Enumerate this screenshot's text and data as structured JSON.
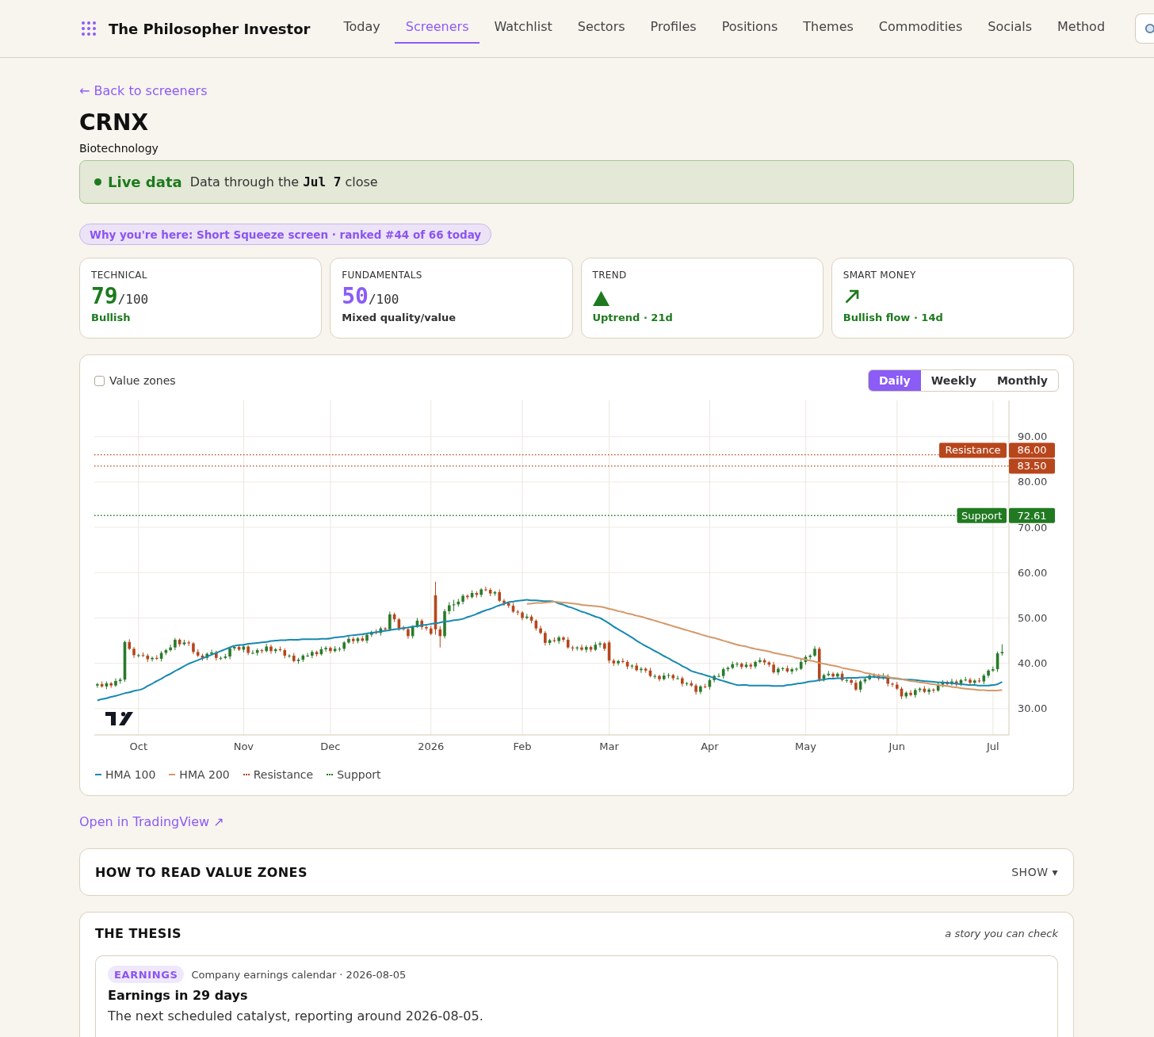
{
  "header": {
    "brand": "The Philosopher Investor",
    "nav": [
      {
        "label": "Today",
        "selected": false
      },
      {
        "label": "Screeners",
        "selected": true
      },
      {
        "label": "Watchlist",
        "selected": false
      },
      {
        "label": "Sectors",
        "selected": false
      },
      {
        "label": "Profiles",
        "selected": false
      },
      {
        "label": "Positions",
        "selected": false
      },
      {
        "label": "Themes",
        "selected": false
      },
      {
        "label": "Commodities",
        "selected": false
      },
      {
        "label": "Socials",
        "selected": false
      },
      {
        "label": "Method",
        "selected": false
      }
    ]
  },
  "back_link": "← Back to screeners",
  "ticker": "CRNX",
  "industry": "Biotechnology",
  "status_banner": {
    "label": "Live data",
    "text": "Data through the **Jul 7** close"
  },
  "reason_pill": "Why you're here: Short Squeeze screen · ranked #44 of 66 today",
  "score_cards": [
    {
      "kind": "score",
      "label": "TECHNICAL",
      "value": "79",
      "max": "/100",
      "note": "Bullish",
      "color": "#1e7a1e",
      "bullish": true
    },
    {
      "kind": "score",
      "label": "FUNDAMENTALS",
      "value": "50",
      "max": "/100",
      "note": "Mixed quality/value",
      "color": "#8b5cf6",
      "bullish": false
    },
    {
      "kind": "trend",
      "label": "TREND",
      "note": "Uptrend · 21d",
      "color": "#1e7a1e",
      "bullish": true
    },
    {
      "kind": "flow",
      "label": "SMART MONEY",
      "note": "Bullish flow · 14d",
      "color": "#1e7a1e",
      "bullish": true
    }
  ],
  "chart": {
    "value_zones": {
      "label": "Value zones",
      "checked": false
    },
    "timeframes": [
      {
        "label": "Daily",
        "selected": true
      },
      {
        "label": "Weekly",
        "selected": false
      },
      {
        "label": "Monthly",
        "selected": false
      }
    ],
    "chart_data": {
      "type": "candlestick",
      "ylim": [
        24.2,
        98
      ],
      "grid": true,
      "categories": [
        null,
        null,
        null,
        null,
        null,
        null,
        null,
        null,
        null,
        "Oct",
        null,
        null,
        null,
        null,
        null,
        null,
        null,
        null,
        null,
        null,
        null,
        null,
        null,
        null,
        null,
        null,
        null,
        null,
        null,
        null,
        null,
        null,
        "Nov",
        null,
        null,
        null,
        null,
        null,
        null,
        null,
        null,
        null,
        null,
        null,
        null,
        null,
        null,
        null,
        null,
        null,
        null,
        "Dec",
        null,
        null,
        null,
        null,
        null,
        null,
        null,
        null,
        null,
        null,
        null,
        null,
        null,
        null,
        null,
        null,
        null,
        null,
        null,
        null,
        null,
        "2026",
        null,
        null,
        null,
        null,
        null,
        null,
        null,
        null,
        null,
        null,
        null,
        null,
        null,
        null,
        null,
        null,
        null,
        null,
        null,
        "Feb",
        null,
        null,
        null,
        null,
        null,
        null,
        null,
        null,
        null,
        null,
        null,
        null,
        null,
        null,
        null,
        null,
        null,
        null,
        "Mar",
        null,
        null,
        null,
        null,
        null,
        null,
        null,
        null,
        null,
        null,
        null,
        null,
        null,
        null,
        null,
        null,
        null,
        null,
        null,
        null,
        null,
        "Apr",
        null,
        null,
        null,
        null,
        null,
        null,
        null,
        null,
        null,
        null,
        null,
        null,
        null,
        null,
        null,
        null,
        null,
        null,
        null,
        null,
        "May",
        null,
        null,
        null,
        null,
        null,
        null,
        null,
        null,
        null,
        null,
        null,
        null,
        null,
        null,
        null,
        null,
        null,
        null,
        null,
        "Jun",
        null,
        null,
        null,
        null,
        null,
        null,
        null,
        null,
        null,
        null,
        null,
        null,
        null,
        null,
        null,
        null,
        null,
        null,
        null,
        null,
        "Jul",
        null,
        null
      ],
      "ohlc": [
        [
          35.1,
          35.7,
          34.6,
          35.4
        ],
        [
          35.4,
          36.0,
          34.6,
          34.9
        ],
        [
          34.9,
          36.0,
          34.3,
          35.6
        ],
        [
          35.6,
          35.9,
          34.6,
          35.1
        ],
        [
          35.1,
          36.7,
          34.8,
          36.1
        ],
        [
          36.1,
          36.8,
          35.5,
          36.4
        ],
        [
          36.4,
          45.0,
          35.9,
          44.7
        ],
        [
          44.7,
          45.3,
          42.9,
          43.2
        ],
        [
          43.2,
          43.6,
          41.2,
          41.8
        ],
        [
          41.8,
          42.1,
          41.3,
          41.8
        ],
        [
          41.8,
          42.4,
          41.4,
          41.7
        ],
        [
          41.7,
          42.1,
          40.3,
          40.9
        ],
        [
          40.9,
          41.5,
          40.4,
          41.2
        ],
        [
          41.2,
          41.8,
          40.7,
          41.0
        ],
        [
          41.0,
          42.7,
          40.4,
          42.3
        ],
        [
          42.3,
          43.2,
          41.8,
          42.9
        ],
        [
          42.9,
          44.1,
          42.6,
          43.5
        ],
        [
          43.5,
          45.6,
          42.9,
          45.2
        ],
        [
          45.2,
          45.5,
          43.7,
          44.2
        ],
        [
          44.2,
          45.2,
          43.9,
          44.6
        ],
        [
          44.6,
          45.0,
          43.8,
          44.4
        ],
        [
          44.4,
          44.7,
          42.0,
          42.5
        ],
        [
          42.5,
          43.1,
          41.4,
          41.7
        ],
        [
          41.7,
          42.1,
          40.6,
          41.2
        ],
        [
          41.2,
          42.4,
          40.7,
          42.1
        ],
        [
          42.1,
          43.0,
          41.8,
          42.4
        ],
        [
          42.4,
          42.8,
          40.6,
          41.2
        ],
        [
          41.2,
          41.5,
          40.7,
          41.2
        ],
        [
          41.2,
          42.1,
          40.9,
          41.5
        ],
        [
          41.5,
          43.7,
          40.9,
          43.3
        ],
        [
          43.3,
          43.9,
          42.8,
          43.6
        ],
        [
          43.6,
          44.2,
          42.7,
          43.0
        ],
        [
          43.0,
          44.1,
          42.4,
          43.7
        ],
        [
          43.7,
          44.0,
          41.8,
          42.3
        ],
        [
          42.3,
          42.9,
          42.0,
          42.3
        ],
        [
          42.3,
          43.3,
          41.7,
          42.9
        ],
        [
          42.9,
          43.2,
          42.2,
          42.7
        ],
        [
          42.7,
          44.3,
          42.4,
          43.7
        ],
        [
          43.7,
          44.1,
          42.1,
          42.7
        ],
        [
          42.7,
          43.4,
          42.2,
          43.1
        ],
        [
          43.1,
          43.7,
          42.6,
          42.9
        ],
        [
          42.9,
          43.3,
          41.1,
          41.7
        ],
        [
          41.7,
          42.0,
          41.2,
          41.7
        ],
        [
          41.7,
          42.3,
          40.2,
          40.5
        ],
        [
          40.5,
          41.2,
          39.9,
          40.8
        ],
        [
          40.8,
          42.0,
          40.3,
          41.7
        ],
        [
          41.7,
          42.3,
          41.4,
          41.7
        ],
        [
          41.7,
          42.9,
          41.1,
          42.5
        ],
        [
          42.5,
          42.8,
          41.5,
          42.0
        ],
        [
          42.0,
          43.7,
          41.7,
          43.1
        ],
        [
          43.1,
          43.8,
          42.5,
          43.4
        ],
        [
          43.4,
          43.7,
          42.2,
          42.7
        ],
        [
          42.7,
          43.8,
          42.4,
          43.2
        ],
        [
          43.2,
          43.6,
          42.6,
          43.2
        ],
        [
          43.2,
          44.9,
          42.7,
          44.6
        ],
        [
          44.6,
          46.0,
          44.3,
          45.4
        ],
        [
          45.4,
          45.8,
          44.3,
          44.9
        ],
        [
          44.9,
          45.8,
          44.4,
          45.5
        ],
        [
          45.5,
          46.1,
          44.7,
          45.0
        ],
        [
          45.0,
          46.7,
          44.4,
          46.3
        ],
        [
          46.3,
          47.2,
          45.8,
          46.9
        ],
        [
          46.9,
          47.5,
          46.4,
          46.7
        ],
        [
          46.7,
          48.1,
          46.1,
          47.7
        ],
        [
          47.7,
          48.0,
          47.0,
          47.5
        ],
        [
          47.5,
          51.4,
          47.2,
          50.8
        ],
        [
          50.8,
          51.2,
          49.1,
          49.7
        ],
        [
          49.7,
          50.0,
          47.2,
          47.7
        ],
        [
          47.7,
          48.3,
          47.2,
          47.5
        ],
        [
          47.5,
          47.9,
          45.4,
          46.0
        ],
        [
          46.0,
          48.4,
          45.5,
          48.1
        ],
        [
          48.1,
          50.0,
          47.8,
          49.4
        ],
        [
          49.4,
          49.8,
          47.4,
          48.0
        ],
        [
          48.0,
          48.3,
          47.2,
          47.7
        ],
        [
          47.7,
          48.3,
          46.2,
          46.5
        ],
        [
          55.0,
          58.0,
          46.3,
          47.5
        ],
        [
          47.5,
          48.2,
          43.5,
          46.0
        ],
        [
          46.0,
          52.0,
          45.5,
          51.5
        ],
        [
          51.5,
          53.5,
          50.8,
          52.8
        ],
        [
          52.8,
          54.0,
          51.5,
          53.0
        ],
        [
          53.0,
          54.2,
          52.5,
          53.6
        ],
        [
          53.6,
          55.3,
          53.0,
          54.9
        ],
        [
          54.9,
          55.2,
          54.1,
          54.6
        ],
        [
          54.6,
          56.1,
          54.3,
          55.5
        ],
        [
          55.5,
          55.9,
          54.5,
          55.1
        ],
        [
          55.1,
          56.6,
          54.6,
          56.3
        ],
        [
          56.3,
          56.9,
          55.9,
          56.2
        ],
        [
          56.2,
          56.6,
          54.8,
          55.4
        ],
        [
          55.4,
          56.0,
          54.9,
          55.7
        ],
        [
          55.7,
          56.3,
          53.5,
          53.8
        ],
        [
          53.8,
          54.2,
          52.7,
          53.3
        ],
        [
          53.3,
          53.6,
          52.2,
          52.7
        ],
        [
          52.7,
          53.3,
          51.1,
          51.4
        ],
        [
          51.4,
          51.8,
          50.6,
          51.2
        ],
        [
          51.2,
          51.5,
          49.5,
          50.0
        ],
        [
          50.0,
          50.9,
          49.7,
          50.3
        ],
        [
          50.3,
          50.7,
          48.8,
          49.4
        ],
        [
          49.4,
          49.7,
          47.2,
          47.7
        ],
        [
          47.7,
          48.3,
          46.4,
          46.7
        ],
        [
          46.7,
          47.1,
          43.9,
          44.5
        ],
        [
          44.5,
          45.4,
          44.0,
          45.1
        ],
        [
          45.1,
          45.7,
          44.6,
          44.9
        ],
        [
          44.9,
          46.1,
          44.3,
          45.7
        ],
        [
          45.7,
          46.0,
          44.7,
          45.2
        ],
        [
          45.2,
          45.8,
          43.2,
          43.5
        ],
        [
          43.5,
          43.9,
          42.7,
          43.3
        ],
        [
          43.3,
          43.8,
          42.8,
          43.5
        ],
        [
          43.5,
          44.1,
          42.7,
          43.0
        ],
        [
          43.0,
          44.0,
          42.4,
          43.6
        ],
        [
          43.6,
          43.9,
          42.5,
          43.0
        ],
        [
          43.0,
          44.7,
          42.7,
          44.1
        ],
        [
          44.1,
          44.8,
          43.5,
          44.4
        ],
        [
          44.4,
          44.7,
          42.7,
          43.2
        ],
        [
          44.6,
          45.0,
          40.0,
          40.6
        ],
        [
          40.6,
          41.0,
          39.4,
          40.0
        ],
        [
          40.0,
          40.8,
          39.5,
          40.5
        ],
        [
          40.5,
          41.1,
          40.0,
          40.3
        ],
        [
          40.3,
          40.7,
          38.7,
          39.3
        ],
        [
          39.3,
          39.8,
          38.8,
          39.5
        ],
        [
          39.5,
          40.1,
          38.2,
          38.5
        ],
        [
          38.5,
          39.2,
          37.9,
          38.8
        ],
        [
          38.8,
          39.1,
          37.9,
          38.4
        ],
        [
          38.4,
          39.0,
          36.9,
          37.2
        ],
        [
          37.2,
          37.6,
          36.6,
          37.2
        ],
        [
          37.2,
          37.5,
          36.0,
          36.5
        ],
        [
          36.5,
          37.9,
          36.2,
          37.3
        ],
        [
          37.3,
          37.8,
          36.7,
          37.4
        ],
        [
          37.4,
          37.7,
          36.2,
          36.7
        ],
        [
          36.7,
          37.3,
          36.4,
          36.7
        ],
        [
          36.7,
          37.1,
          34.9,
          35.5
        ],
        [
          35.5,
          35.9,
          35.0,
          35.6
        ],
        [
          35.6,
          36.2,
          34.8,
          35.1
        ],
        [
          35.1,
          35.5,
          33.1,
          33.7
        ],
        [
          33.7,
          35.2,
          33.2,
          34.9
        ],
        [
          34.9,
          35.5,
          34.5,
          34.8
        ],
        [
          34.8,
          36.7,
          34.2,
          36.3
        ],
        [
          36.3,
          37.5,
          35.8,
          37.2
        ],
        [
          37.2,
          37.8,
          36.9,
          37.2
        ],
        [
          37.2,
          39.1,
          36.6,
          38.7
        ],
        [
          38.7,
          39.3,
          38.2,
          39.0
        ],
        [
          39.0,
          40.4,
          38.7,
          39.8
        ],
        [
          39.8,
          40.3,
          39.2,
          39.9
        ],
        [
          39.9,
          40.2,
          38.7,
          39.2
        ],
        [
          39.2,
          40.3,
          38.9,
          39.7
        ],
        [
          39.7,
          40.1,
          38.7,
          39.3
        ],
        [
          39.3,
          40.6,
          38.8,
          40.3
        ],
        [
          40.3,
          41.3,
          40.0,
          40.7
        ],
        [
          40.7,
          41.1,
          39.6,
          40.2
        ],
        [
          40.2,
          40.5,
          39.2,
          39.7
        ],
        [
          39.7,
          40.3,
          37.7,
          38.0
        ],
        [
          38.0,
          39.2,
          37.4,
          38.8
        ],
        [
          38.8,
          39.2,
          38.3,
          38.9
        ],
        [
          38.9,
          39.5,
          37.9,
          38.2
        ],
        [
          38.2,
          39.1,
          37.6,
          38.7
        ],
        [
          38.7,
          39.1,
          38.2,
          38.8
        ],
        [
          38.8,
          40.9,
          38.5,
          40.3
        ],
        [
          40.3,
          41.8,
          39.7,
          41.4
        ],
        [
          41.4,
          42.0,
          40.9,
          41.7
        ],
        [
          41.7,
          43.8,
          41.4,
          43.2
        ],
        [
          43.2,
          43.6,
          35.9,
          36.5
        ],
        [
          36.5,
          37.7,
          36.0,
          37.4
        ],
        [
          37.4,
          38.3,
          37.1,
          37.7
        ],
        [
          37.7,
          38.1,
          36.5,
          37.1
        ],
        [
          37.1,
          38.0,
          36.6,
          37.7
        ],
        [
          37.7,
          38.3,
          36.0,
          36.3
        ],
        [
          36.3,
          36.7,
          35.7,
          36.3
        ],
        [
          36.3,
          36.6,
          35.2,
          35.7
        ],
        [
          35.7,
          36.3,
          33.9,
          34.2
        ],
        [
          34.2,
          36.4,
          33.6,
          36.0
        ],
        [
          36.0,
          36.8,
          35.5,
          36.5
        ],
        [
          36.5,
          37.9,
          36.2,
          37.3
        ],
        [
          37.3,
          37.8,
          36.7,
          37.4
        ],
        [
          37.4,
          37.7,
          36.2,
          36.7
        ],
        [
          36.7,
          37.8,
          36.4,
          37.2
        ],
        [
          37.2,
          37.6,
          34.9,
          35.5
        ],
        [
          35.5,
          35.8,
          34.8,
          35.3
        ],
        [
          35.3,
          35.9,
          34.1,
          34.4
        ],
        [
          34.4,
          34.8,
          32.1,
          32.7
        ],
        [
          32.7,
          33.8,
          32.2,
          33.5
        ],
        [
          33.5,
          34.1,
          32.7,
          33.0
        ],
        [
          33.0,
          34.5,
          32.4,
          34.1
        ],
        [
          34.1,
          34.7,
          33.6,
          34.4
        ],
        [
          34.4,
          35.0,
          33.4,
          33.7
        ],
        [
          33.7,
          34.6,
          33.1,
          34.2
        ],
        [
          34.2,
          34.5,
          33.5,
          34.0
        ],
        [
          34.0,
          35.9,
          33.7,
          35.3
        ],
        [
          35.3,
          36.3,
          34.7,
          35.9
        ],
        [
          35.9,
          36.2,
          34.9,
          35.4
        ],
        [
          35.4,
          36.6,
          35.1,
          36.0
        ],
        [
          36.0,
          36.4,
          34.9,
          35.5
        ],
        [
          35.5,
          36.6,
          35.0,
          36.3
        ],
        [
          36.3,
          37.0,
          36.0,
          36.4
        ],
        [
          36.4,
          36.8,
          35.1,
          35.7
        ],
        [
          35.7,
          36.5,
          35.2,
          36.2
        ],
        [
          36.2,
          36.8,
          35.7,
          36.0
        ],
        [
          36.0,
          37.7,
          35.4,
          37.3
        ],
        [
          37.3,
          38.7,
          36.8,
          38.4
        ],
        [
          38.4,
          39.3,
          38.1,
          38.7
        ],
        [
          38.7,
          42.6,
          38.1,
          42.2
        ],
        [
          42.2,
          44.2,
          41.7,
          42.5
        ]
      ],
      "series": [
        {
          "name": "HMA 100",
          "type": "line",
          "color": "#1789b0",
          "values": [
            31.8,
            32.1,
            32.3,
            32.6,
            32.8,
            33.1,
            33.4,
            33.6,
            33.9,
            34.1,
            34.4,
            35.0,
            35.5,
            36.1,
            36.6,
            37.2,
            37.7,
            38.3,
            38.8,
            39.4,
            39.9,
            40.3,
            40.7,
            41.1,
            41.5,
            41.9,
            42.3,
            42.7,
            43.1,
            43.5,
            43.9,
            44.0,
            44.1,
            44.3,
            44.4,
            44.5,
            44.6,
            44.7,
            44.9,
            45.0,
            45.1,
            45.1,
            45.2,
            45.2,
            45.2,
            45.3,
            45.3,
            45.3,
            45.3,
            45.4,
            45.4,
            45.5,
            45.7,
            45.8,
            45.9,
            46.1,
            46.2,
            46.3,
            46.4,
            46.6,
            46.7,
            46.9,
            47.0,
            47.2,
            47.3,
            47.5,
            47.6,
            47.8,
            47.9,
            48.1,
            48.2,
            48.4,
            48.5,
            48.7,
            48.8,
            49.0,
            49.2,
            49.3,
            49.5,
            49.6,
            49.8,
            50.2,
            50.5,
            50.9,
            51.3,
            51.7,
            52.0,
            52.4,
            52.8,
            53.1,
            53.5,
            53.6,
            53.8,
            53.9,
            54.0,
            53.9,
            53.9,
            53.8,
            53.7,
            53.7,
            53.6,
            53.2,
            52.9,
            52.5,
            52.2,
            51.8,
            51.4,
            51.1,
            50.7,
            50.3,
            50.0,
            49.4,
            48.8,
            48.1,
            47.5,
            46.9,
            46.3,
            45.7,
            45.0,
            44.4,
            43.8,
            43.3,
            42.7,
            42.2,
            41.6,
            41.1,
            40.5,
            40.0,
            39.4,
            38.9,
            38.3,
            38.0,
            37.7,
            37.4,
            37.1,
            36.8,
            36.4,
            36.1,
            35.8,
            35.5,
            35.2,
            35.2,
            35.2,
            35.1,
            35.1,
            35.1,
            35.1,
            35.1,
            35.0,
            35.0,
            35.0,
            35.2,
            35.3,
            35.5,
            35.6,
            35.8,
            36.0,
            36.1,
            36.3,
            36.4,
            36.6,
            36.6,
            36.7,
            36.7,
            36.8,
            36.8,
            36.8,
            36.9,
            36.9,
            37.0,
            37.0,
            36.9,
            36.8,
            36.8,
            36.7,
            36.6,
            36.5,
            36.4,
            36.4,
            36.3,
            36.2,
            36.1,
            36.0,
            35.9,
            35.8,
            35.8,
            35.7,
            35.6,
            35.5,
            35.4,
            35.3,
            35.2,
            35.2,
            35.1,
            35.1,
            35.1,
            35.2,
            35.4,
            35.9
          ]
        },
        {
          "name": "HMA 200",
          "type": "line",
          "color": "#d4996a",
          "values": [
            null,
            null,
            null,
            null,
            null,
            null,
            null,
            null,
            null,
            null,
            null,
            null,
            null,
            null,
            null,
            null,
            null,
            null,
            null,
            null,
            null,
            null,
            null,
            null,
            null,
            null,
            null,
            null,
            null,
            null,
            null,
            null,
            null,
            null,
            null,
            null,
            null,
            null,
            null,
            null,
            null,
            null,
            null,
            null,
            null,
            null,
            null,
            null,
            null,
            null,
            null,
            null,
            null,
            null,
            null,
            null,
            null,
            null,
            null,
            null,
            null,
            null,
            null,
            null,
            null,
            null,
            null,
            null,
            null,
            null,
            null,
            null,
            null,
            null,
            null,
            null,
            null,
            null,
            null,
            null,
            null,
            null,
            null,
            null,
            null,
            null,
            null,
            null,
            null,
            null,
            null,
            null,
            null,
            null,
            53.1,
            53.2,
            53.3,
            53.3,
            53.4,
            53.5,
            53.6,
            53.5,
            53.4,
            53.3,
            53.2,
            53.1,
            52.9,
            52.8,
            52.7,
            52.6,
            52.5,
            52.3,
            52.0,
            51.8,
            51.5,
            51.3,
            51.0,
            50.8,
            50.5,
            50.3,
            50.0,
            49.7,
            49.4,
            49.1,
            48.8,
            48.5,
            48.2,
            47.9,
            47.6,
            47.3,
            47.0,
            46.7,
            46.4,
            46.1,
            45.8,
            45.6,
            45.3,
            45.0,
            44.7,
            44.4,
            44.1,
            43.9,
            43.7,
            43.4,
            43.2,
            43.0,
            42.8,
            42.6,
            42.3,
            42.1,
            41.9,
            41.7,
            41.5,
            41.2,
            41.0,
            40.8,
            40.6,
            40.4,
            40.1,
            39.9,
            39.7,
            39.5,
            39.3,
            39.0,
            38.8,
            38.6,
            38.4,
            38.2,
            37.9,
            37.7,
            37.5,
            37.3,
            37.2,
            37.0,
            36.8,
            36.7,
            36.5,
            36.3,
            36.1,
            36.0,
            35.8,
            35.7,
            35.5,
            35.4,
            35.2,
            35.1,
            35.0,
            34.8,
            34.7,
            34.5,
            34.4,
            34.3,
            34.2,
            34.1,
            34.1,
            34.0,
            34.0,
            34.0,
            34.1
          ]
        }
      ],
      "yticks": [
        {
          "value": 30,
          "label": "30.00"
        },
        {
          "value": 40,
          "label": "40.00"
        },
        {
          "value": 50,
          "label": "50.00"
        },
        {
          "value": 60,
          "label": "60.00"
        },
        {
          "value": 70,
          "label": "70.00"
        },
        {
          "value": 80,
          "label": "80.00"
        },
        {
          "value": 90,
          "label": "90.00"
        }
      ],
      "ref_lines": [
        {
          "axis": "y",
          "value": 86,
          "label": "Resistance",
          "color": "#b8461c"
        },
        {
          "axis": "y",
          "value": 83.5,
          "color": "#b8461c"
        },
        {
          "axis": "y",
          "value": 72.61,
          "label": "Support",
          "color": "#217a21"
        }
      ],
      "annotations": [
        "86.00",
        "83.50",
        "72.61"
      ]
    },
    "legend": [
      {
        "label": "Resistance",
        "color": "#b8461c"
      },
      {
        "label": "Support",
        "color": "#217a21"
      }
    ]
  },
  "chart_link": "Open in TradingView ↗",
  "value_zones_help": {
    "title": "HOW TO READ VALUE ZONES",
    "toggle": "SHOW ▾"
  },
  "thesis": {
    "title": "THE THESIS",
    "subtitle": "a story you can check",
    "items": [
      {
        "tag": "EARNINGS",
        "source": "Company earnings calendar · 2026-08-05",
        "headline": "Earnings in 29 days",
        "body": "The next scheduled catalyst, reporting around 2026-08-05."
      }
    ]
  }
}
